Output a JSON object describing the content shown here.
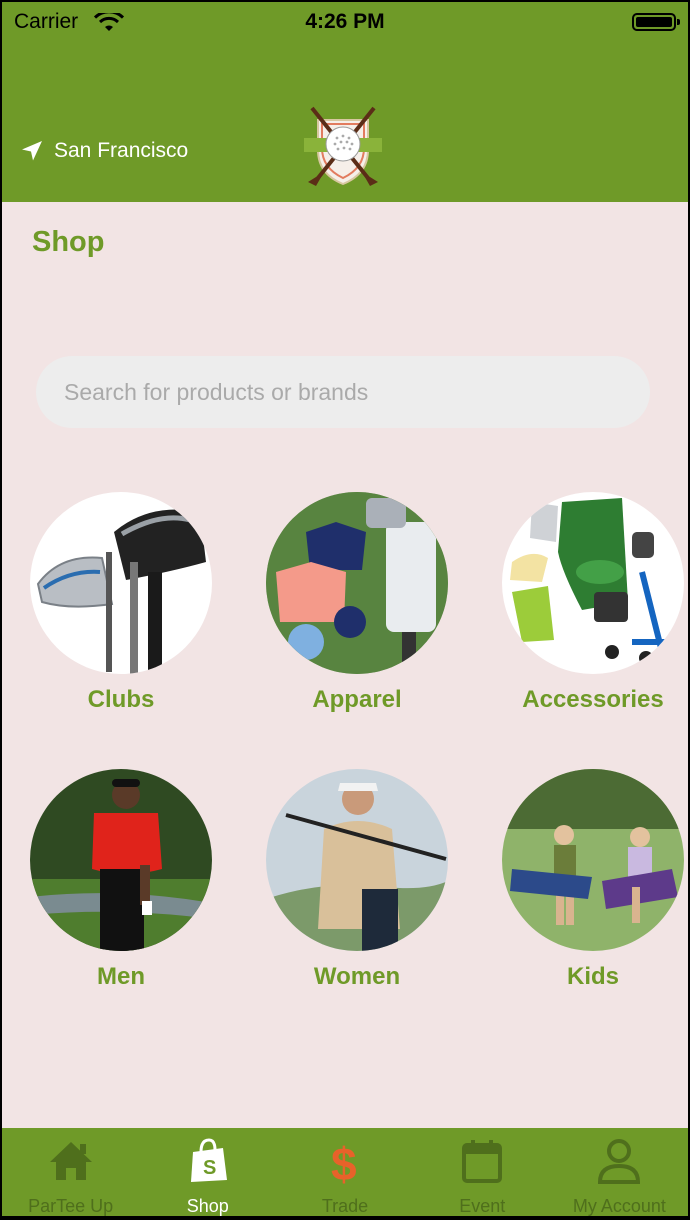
{
  "status_bar": {
    "carrier": "Carrier",
    "time": "4:26 PM"
  },
  "header": {
    "location": "San Francisco",
    "location_icon": "location-arrow-icon",
    "logo": "golf-ball-crossed-clubs-logo"
  },
  "page": {
    "title": "Shop"
  },
  "search": {
    "placeholder": "Search for products or brands",
    "value": ""
  },
  "categories": [
    {
      "label": "Clubs",
      "image": "golf-clubs-photo"
    },
    {
      "label": "Apparel",
      "image": "golf-apparel-photo"
    },
    {
      "label": "Accessories",
      "image": "golf-accessories-photo"
    },
    {
      "label": "Men",
      "image": "man-golfer-photo"
    },
    {
      "label": "Women",
      "image": "woman-golfer-photo"
    },
    {
      "label": "Kids",
      "image": "kids-golfers-photo"
    }
  ],
  "tabbar": {
    "items": [
      {
        "label": "ParTee Up",
        "icon": "home-icon",
        "active": false
      },
      {
        "label": "Shop",
        "icon": "shopping-bag-icon",
        "active": true
      },
      {
        "label": "Trade",
        "icon": "dollar-icon",
        "active": false
      },
      {
        "label": "Event",
        "icon": "calendar-icon",
        "active": false
      },
      {
        "label": "My Account",
        "icon": "user-icon",
        "active": false
      }
    ]
  },
  "colors": {
    "brand_green": "#6f9a28",
    "background": "#f2e4e4",
    "trade_accent": "#e8622a",
    "inactive_tab": "#4f6f1c"
  }
}
